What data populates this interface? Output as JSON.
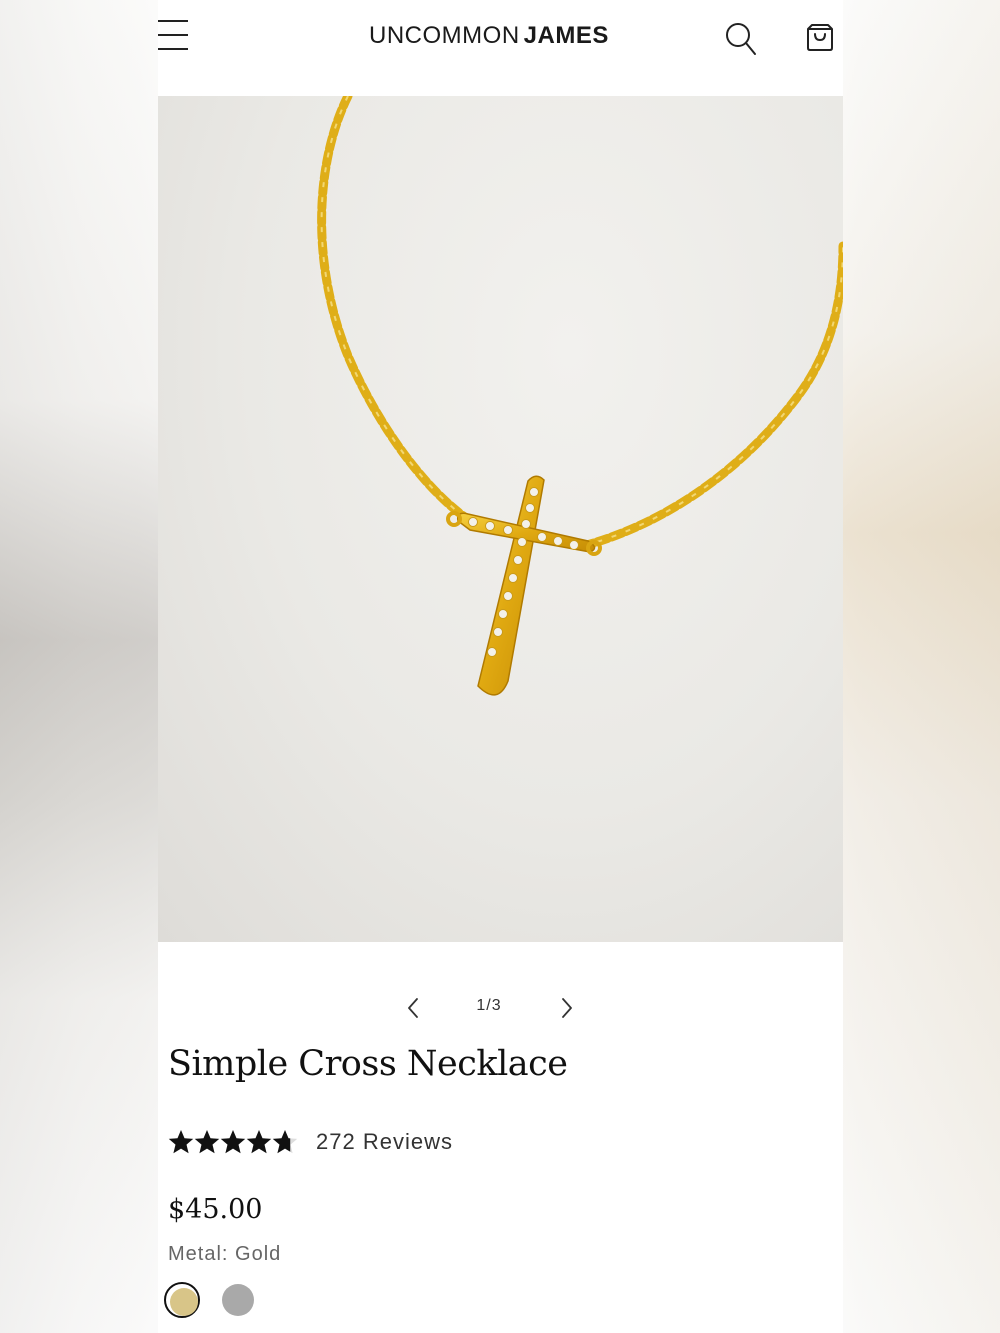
{
  "header": {
    "brand_light": "UNCOMMON",
    "brand_bold": "JAMES"
  },
  "icons": {
    "menu": "hamburger-menu-icon",
    "search": "search-icon",
    "cart": "shopping-bag-icon",
    "prev": "chevron-left-icon",
    "next": "chevron-right-icon",
    "star": "star-icon"
  },
  "carousel": {
    "counter": "1/3",
    "current": 1,
    "total": 3
  },
  "product": {
    "title": "Simple Cross Necklace",
    "rating_value": 4.7,
    "rating_max": 5,
    "reviews_label": "272 Reviews",
    "price": "$45.00",
    "metal_label": "Metal: Gold",
    "swatches": [
      {
        "name": "Gold",
        "color": "#d8c588",
        "selected": true
      },
      {
        "name": "Silver",
        "color": "#a9a9a9",
        "selected": false
      }
    ]
  },
  "colors": {
    "text": "#111111",
    "gold": "#e3b21a",
    "star": "#111111"
  }
}
